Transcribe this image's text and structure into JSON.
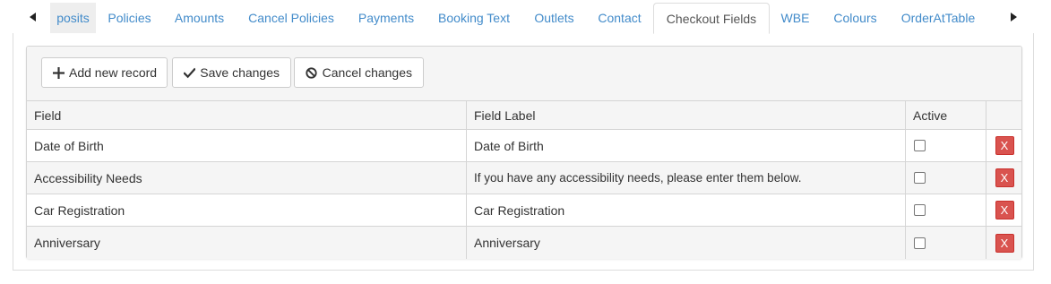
{
  "tabs": [
    {
      "label": "posits",
      "state": "partial"
    },
    {
      "label": "Policies",
      "state": "normal"
    },
    {
      "label": "Amounts",
      "state": "normal"
    },
    {
      "label": "Cancel Policies",
      "state": "normal"
    },
    {
      "label": "Payments",
      "state": "normal"
    },
    {
      "label": "Booking Text",
      "state": "normal"
    },
    {
      "label": "Outlets",
      "state": "normal"
    },
    {
      "label": "Contact",
      "state": "normal"
    },
    {
      "label": "Checkout Fields",
      "state": "active"
    },
    {
      "label": "WBE",
      "state": "normal"
    },
    {
      "label": "Colours",
      "state": "normal"
    },
    {
      "label": "OrderAtTable",
      "state": "normal"
    }
  ],
  "toolbar": {
    "add_label": "Add new record",
    "save_label": "Save changes",
    "cancel_label": "Cancel changes"
  },
  "table": {
    "headers": {
      "field": "Field",
      "label": "Field Label",
      "active": "Active"
    },
    "rows": [
      {
        "field": "Date of Birth",
        "label": "Date of Birth",
        "active": false,
        "delete_label": "X"
      },
      {
        "field": "Accessibility Needs",
        "label": "If you have any accessibility needs, please enter them below.",
        "active": false,
        "delete_label": "X"
      },
      {
        "field": "Car Registration",
        "label": "Car Registration",
        "active": false,
        "delete_label": "X"
      },
      {
        "field": "Anniversary",
        "label": "Anniversary",
        "active": false,
        "delete_label": "X"
      }
    ]
  },
  "icons": {
    "scroll_left": "caret-left-icon",
    "scroll_right": "caret-right-icon",
    "add": "plus-icon",
    "save": "check-icon",
    "cancel": "cancel-circle-icon"
  },
  "colors": {
    "link": "#428bca",
    "active_tab_text": "#555555",
    "delete_button": "#d9534f",
    "toolbar_bg": "#f5f5f5",
    "border": "#d5d5d5"
  }
}
